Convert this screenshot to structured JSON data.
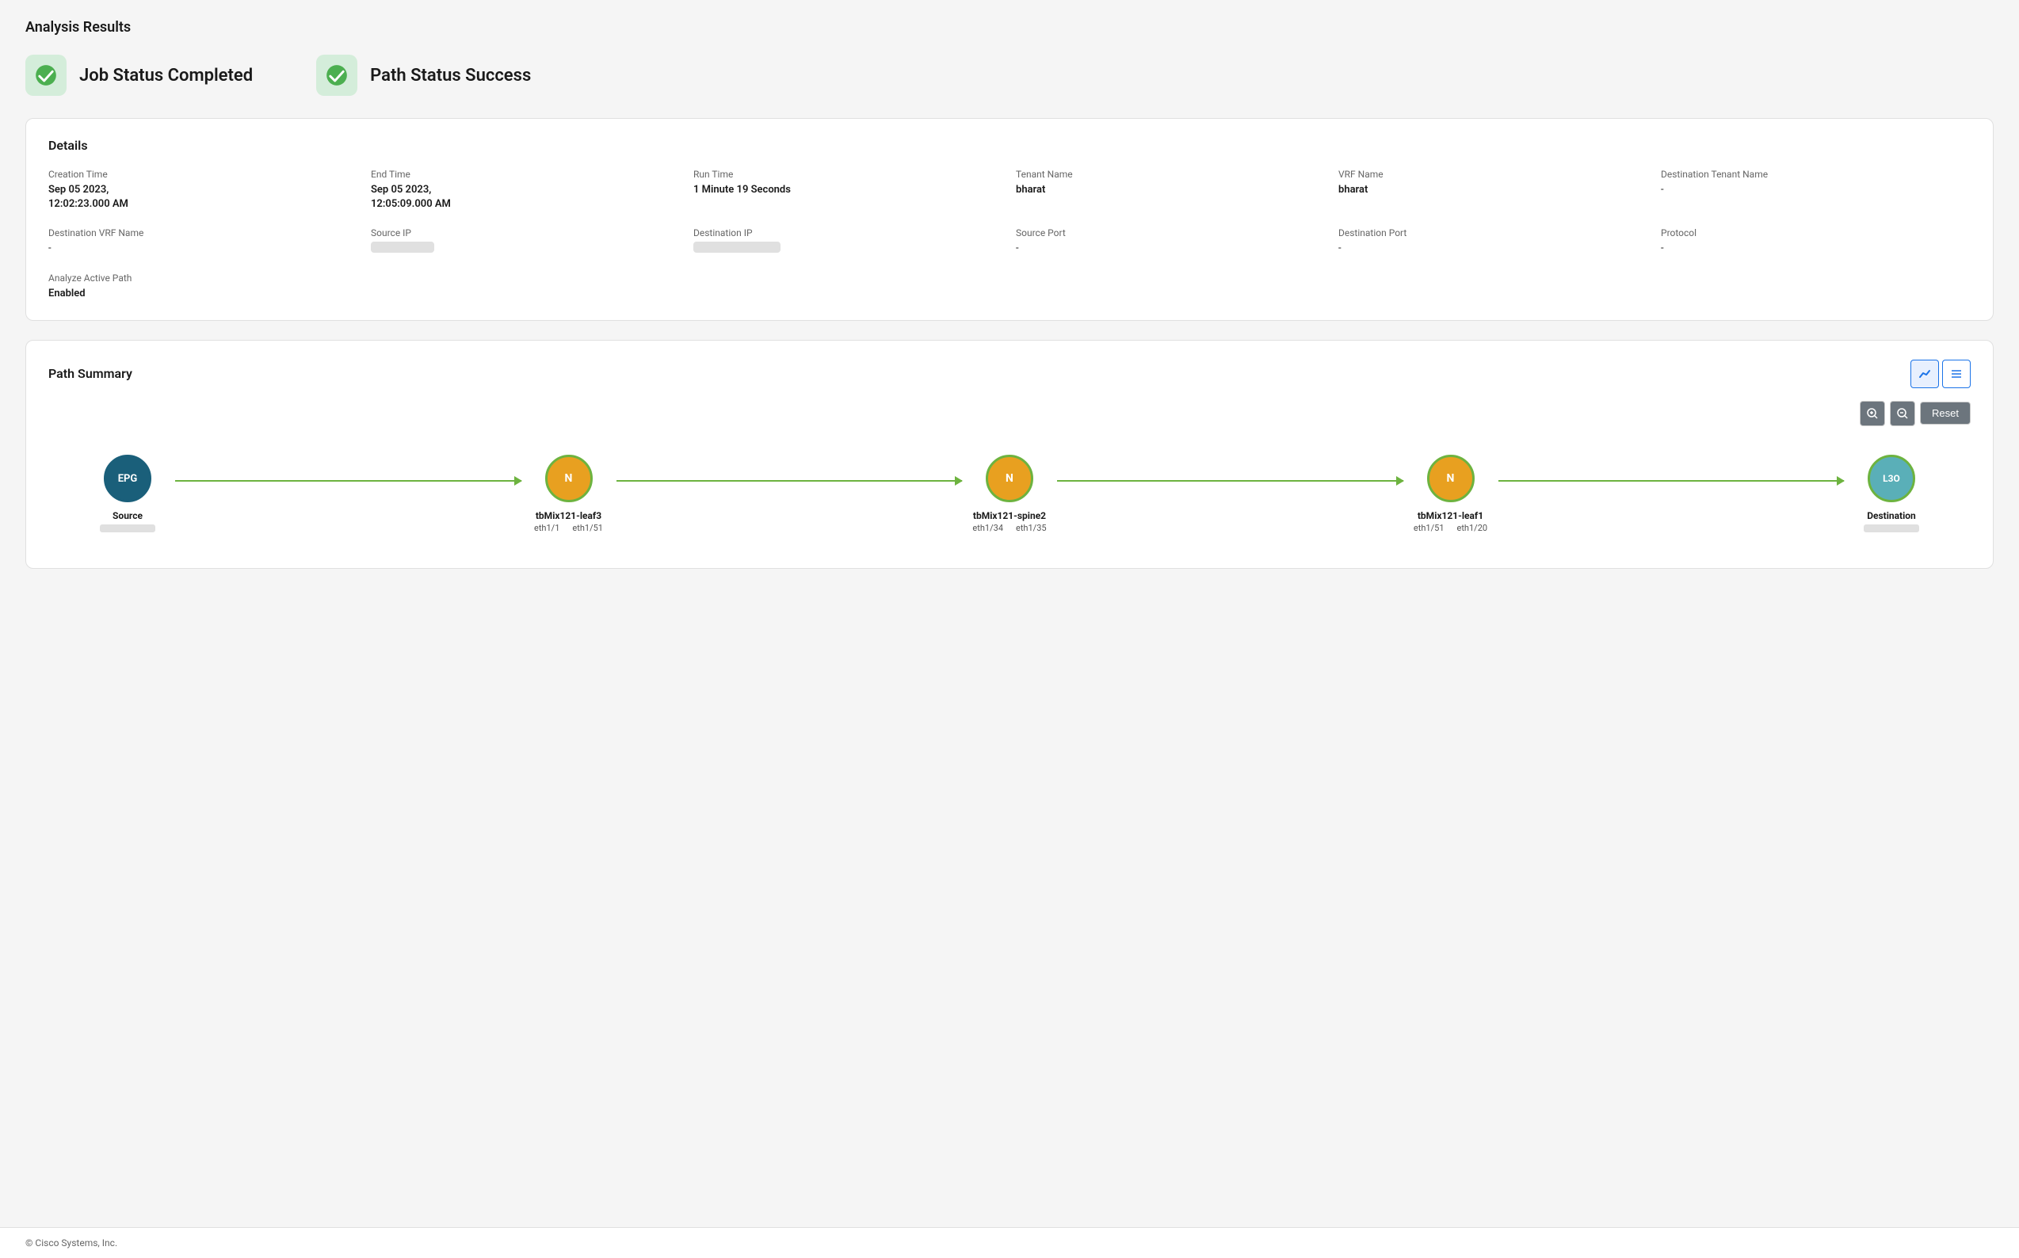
{
  "page": {
    "title": "Analysis Results"
  },
  "jobStatus": {
    "label": "Job Status Completed",
    "iconColor": "#d4edda",
    "checkColor": "#4CAF50"
  },
  "pathStatus": {
    "label": "Path Status Success",
    "iconColor": "#d4edda",
    "checkColor": "#4CAF50"
  },
  "details": {
    "title": "Details",
    "fields": [
      {
        "label": "Creation Time",
        "value": "Sep 05 2023, 12:02:23.000 AM",
        "type": "text"
      },
      {
        "label": "End Time",
        "value": "Sep 05 2023, 12:05:09.000 AM",
        "type": "text"
      },
      {
        "label": "Run Time",
        "value": "1 Minute 19 Seconds",
        "type": "text"
      },
      {
        "label": "Tenant Name",
        "value": "bharat",
        "type": "text"
      },
      {
        "label": "VRF Name",
        "value": "bharat",
        "type": "text"
      },
      {
        "label": "Destination Tenant Name",
        "value": "-",
        "type": "dash"
      }
    ],
    "fields2": [
      {
        "label": "Destination VRF Name",
        "value": "-",
        "type": "dash"
      },
      {
        "label": "Source IP",
        "value": "",
        "type": "redacted"
      },
      {
        "label": "Destination IP",
        "value": "",
        "type": "redacted"
      },
      {
        "label": "Source Port",
        "value": "-",
        "type": "dash"
      },
      {
        "label": "Destination Port",
        "value": "-",
        "type": "dash"
      },
      {
        "label": "Protocol",
        "value": "-",
        "type": "dash"
      }
    ],
    "analyzeLabel": "Analyze Active Path",
    "analyzeValue": "Enabled"
  },
  "pathSummary": {
    "title": "Path Summary",
    "zoomInLabel": "+",
    "zoomOutLabel": "-",
    "resetLabel": "Reset",
    "nodes": [
      {
        "type": "epg",
        "label": "EPG",
        "name": "Source",
        "hasRedacted": true,
        "ports": []
      },
      {
        "type": "n",
        "label": "N",
        "name": "tbMix121-leaf3",
        "hasRedacted": false,
        "ports": [
          "eth1/1",
          "eth1/51"
        ]
      },
      {
        "type": "n",
        "label": "N",
        "name": "tbMix121-spine2",
        "hasRedacted": false,
        "ports": [
          "eth1/34",
          "eth1/35"
        ]
      },
      {
        "type": "n",
        "label": "N",
        "name": "tbMix121-leaf1",
        "hasRedacted": false,
        "ports": [
          "eth1/51",
          "eth1/20"
        ]
      },
      {
        "type": "l3o",
        "label": "L3O",
        "name": "Destination",
        "hasRedacted": true,
        "ports": []
      }
    ]
  },
  "footer": {
    "text": "© Cisco Systems, Inc."
  }
}
